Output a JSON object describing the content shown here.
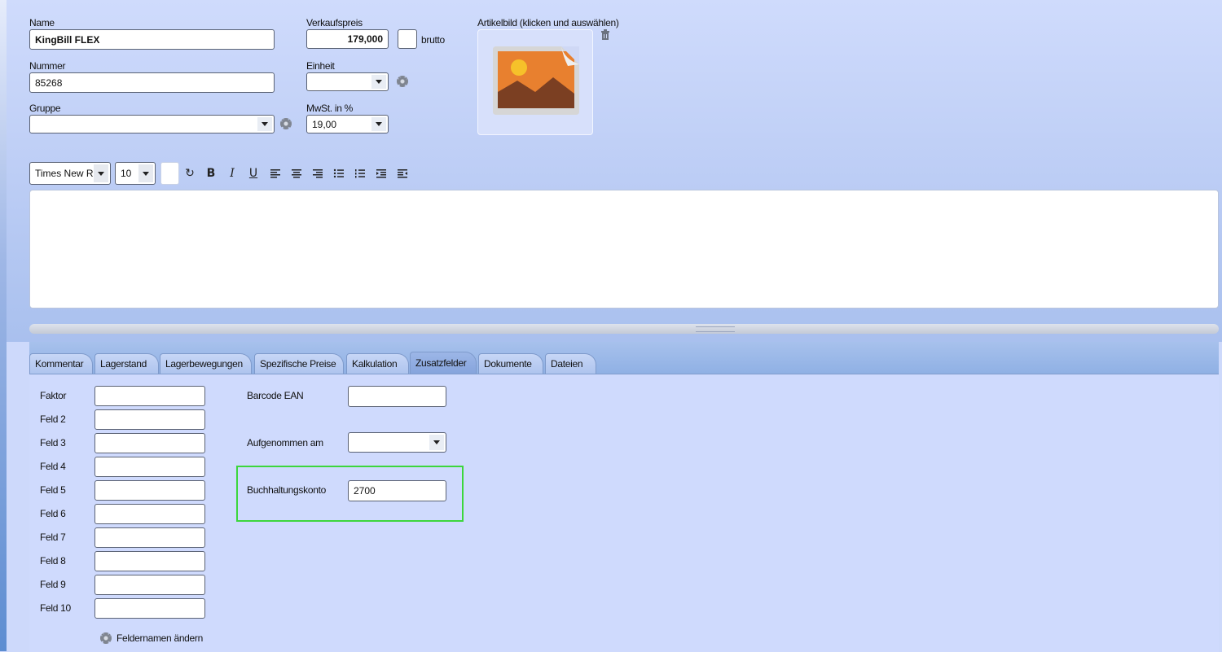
{
  "article": {
    "name_label": "Name",
    "name_value": "KingBill FLEX",
    "number_label": "Nummer",
    "number_value": "85268",
    "group_label": "Gruppe",
    "group_value": "",
    "price_label": "Verkaufspreis",
    "price_value": "179,000",
    "brutto_label": "brutto",
    "unit_label": "Einheit",
    "unit_value": "",
    "vat_label": "MwSt. in %",
    "vat_value": "19,00",
    "image_label": "Artikelbild (klicken und auswählen)"
  },
  "icons": {
    "delete": "trash-icon",
    "settings": "gear-icon",
    "image": "image-placeholder-icon"
  },
  "editor_toolbar": {
    "font_value": "Times New Rc",
    "size_value": "10",
    "undo": "↻",
    "bold": "B",
    "italic": "I",
    "underline": "U"
  },
  "tabs": [
    {
      "label": "Kommentar"
    },
    {
      "label": "Lagerstand"
    },
    {
      "label": "Lagerbewegungen"
    },
    {
      "label": "Spezifische Preise"
    },
    {
      "label": "Kalkulation"
    },
    {
      "label": "Zusatzfelder"
    },
    {
      "label": "Dokumente"
    },
    {
      "label": "Dateien"
    }
  ],
  "active_tab": "Zusatzfelder",
  "extra_fields": [
    {
      "label": "Faktor",
      "value": ""
    },
    {
      "label": "Feld 2",
      "value": ""
    },
    {
      "label": "Feld 3",
      "value": ""
    },
    {
      "label": "Feld 4",
      "value": ""
    },
    {
      "label": "Feld 5",
      "value": ""
    },
    {
      "label": "Feld 6",
      "value": ""
    },
    {
      "label": "Feld 7",
      "value": ""
    },
    {
      "label": "Feld 8",
      "value": ""
    },
    {
      "label": "Feld 9",
      "value": ""
    },
    {
      "label": "Feld 10",
      "value": ""
    }
  ],
  "right_fields": {
    "barcode_label": "Barcode EAN",
    "barcode_value": "",
    "recorded_label": "Aufgenommen am",
    "recorded_value": "",
    "account_label": "Buchhaltungskonto",
    "account_value": "2700"
  },
  "rename_fields_label": "Feldernamen ändern",
  "colors": {
    "highlight": "#3cd63c",
    "background": "#cdd9fb",
    "accent_orange": "#e8802f"
  }
}
